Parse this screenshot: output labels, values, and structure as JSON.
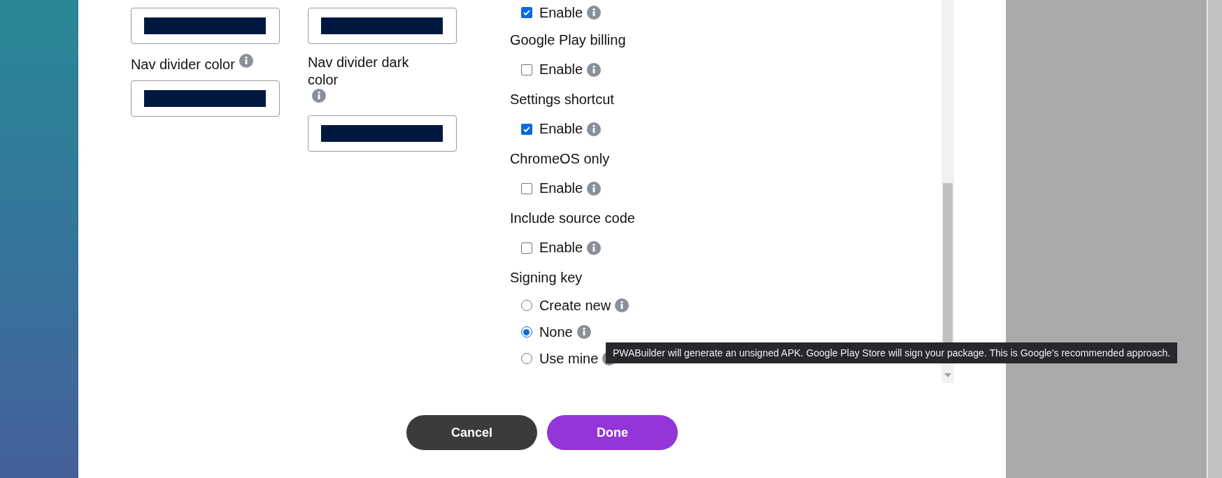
{
  "color_fields": [
    [
      {
        "kind": "swatch"
      },
      {
        "kind": "swatch",
        "label": "Nav divider color"
      }
    ],
    [
      {
        "kind": "swatch"
      },
      {
        "kind": "swatch",
        "label": "Nav divider dark color"
      }
    ]
  ],
  "settings": [
    {
      "controls": [
        {
          "kind": "checkbox",
          "label": "Enable",
          "checked": true
        }
      ]
    },
    {
      "heading": "Google Play billing",
      "controls": [
        {
          "kind": "checkbox",
          "label": "Enable",
          "checked": false
        }
      ]
    },
    {
      "heading": "Settings shortcut",
      "controls": [
        {
          "kind": "checkbox",
          "label": "Enable",
          "checked": true
        }
      ]
    },
    {
      "heading": "ChromeOS only",
      "controls": [
        {
          "kind": "checkbox",
          "label": "Enable",
          "checked": false
        }
      ]
    },
    {
      "heading": "Include source code",
      "controls": [
        {
          "kind": "checkbox",
          "label": "Enable",
          "checked": false
        }
      ]
    },
    {
      "heading": "Signing key",
      "controls": [
        {
          "kind": "radio",
          "label": "Create new",
          "selected": false
        },
        {
          "kind": "radio",
          "label": "None",
          "selected": true
        },
        {
          "kind": "radio",
          "label": "Use mine",
          "selected": false
        }
      ]
    }
  ],
  "tooltip": {
    "text": "PWABuilder will generate an unsigned APK. Google Play Store will sign your package. This is Google's recommended approach."
  },
  "buttons": [
    {
      "label": "Cancel",
      "kind": "secondary"
    },
    {
      "label": "Done",
      "kind": "primary"
    }
  ]
}
